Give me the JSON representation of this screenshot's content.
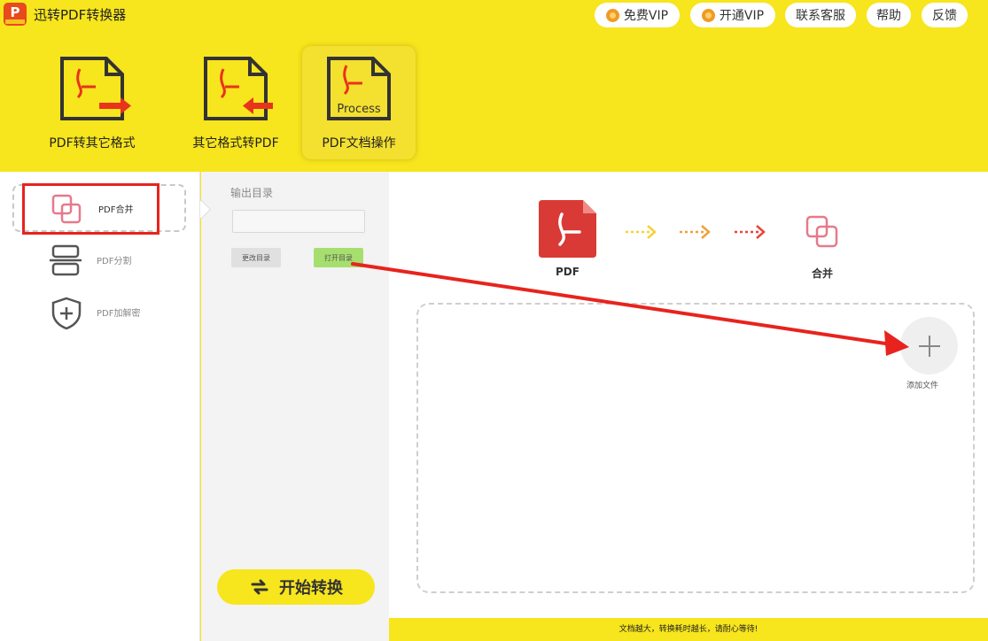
{
  "app": {
    "title": "迅转PDF转换器",
    "logo_letter": "P"
  },
  "top_buttons": [
    {
      "label": "免费VIP"
    },
    {
      "label": "开通VIP"
    },
    {
      "label": "联系客服"
    },
    {
      "label": "帮助"
    },
    {
      "label": "反馈"
    }
  ],
  "toolbar": {
    "tools": [
      {
        "label": "PDF转其它格式"
      },
      {
        "label": "其它格式转PDF"
      },
      {
        "label": "PDF文档操作",
        "icon_text": "Process",
        "active": true
      }
    ]
  },
  "leftnav": {
    "items": [
      {
        "label": "PDF合并",
        "active": true
      },
      {
        "label": "PDF分割"
      },
      {
        "label": "PDF加解密"
      }
    ]
  },
  "middle": {
    "output_label": "输出目录",
    "output_value": "",
    "change_dir_label": "更改目录",
    "open_dir_label": "打开目录",
    "start_label": "开始转换"
  },
  "flow": {
    "source_label": "PDF",
    "target_label": "合并",
    "arrow_colors": [
      "#f5d23a",
      "#f0a13c",
      "#e8453c"
    ]
  },
  "dropzone": {
    "add_label": "添加文件"
  },
  "status": {
    "message": "文档越大，转换耗时越长，请耐心等待!"
  },
  "colors": {
    "brand_yellow": "#f7e51d",
    "pdf_red": "#d93a35",
    "highlight_red": "#e8231d",
    "merge_pink": "#e57a8c"
  }
}
